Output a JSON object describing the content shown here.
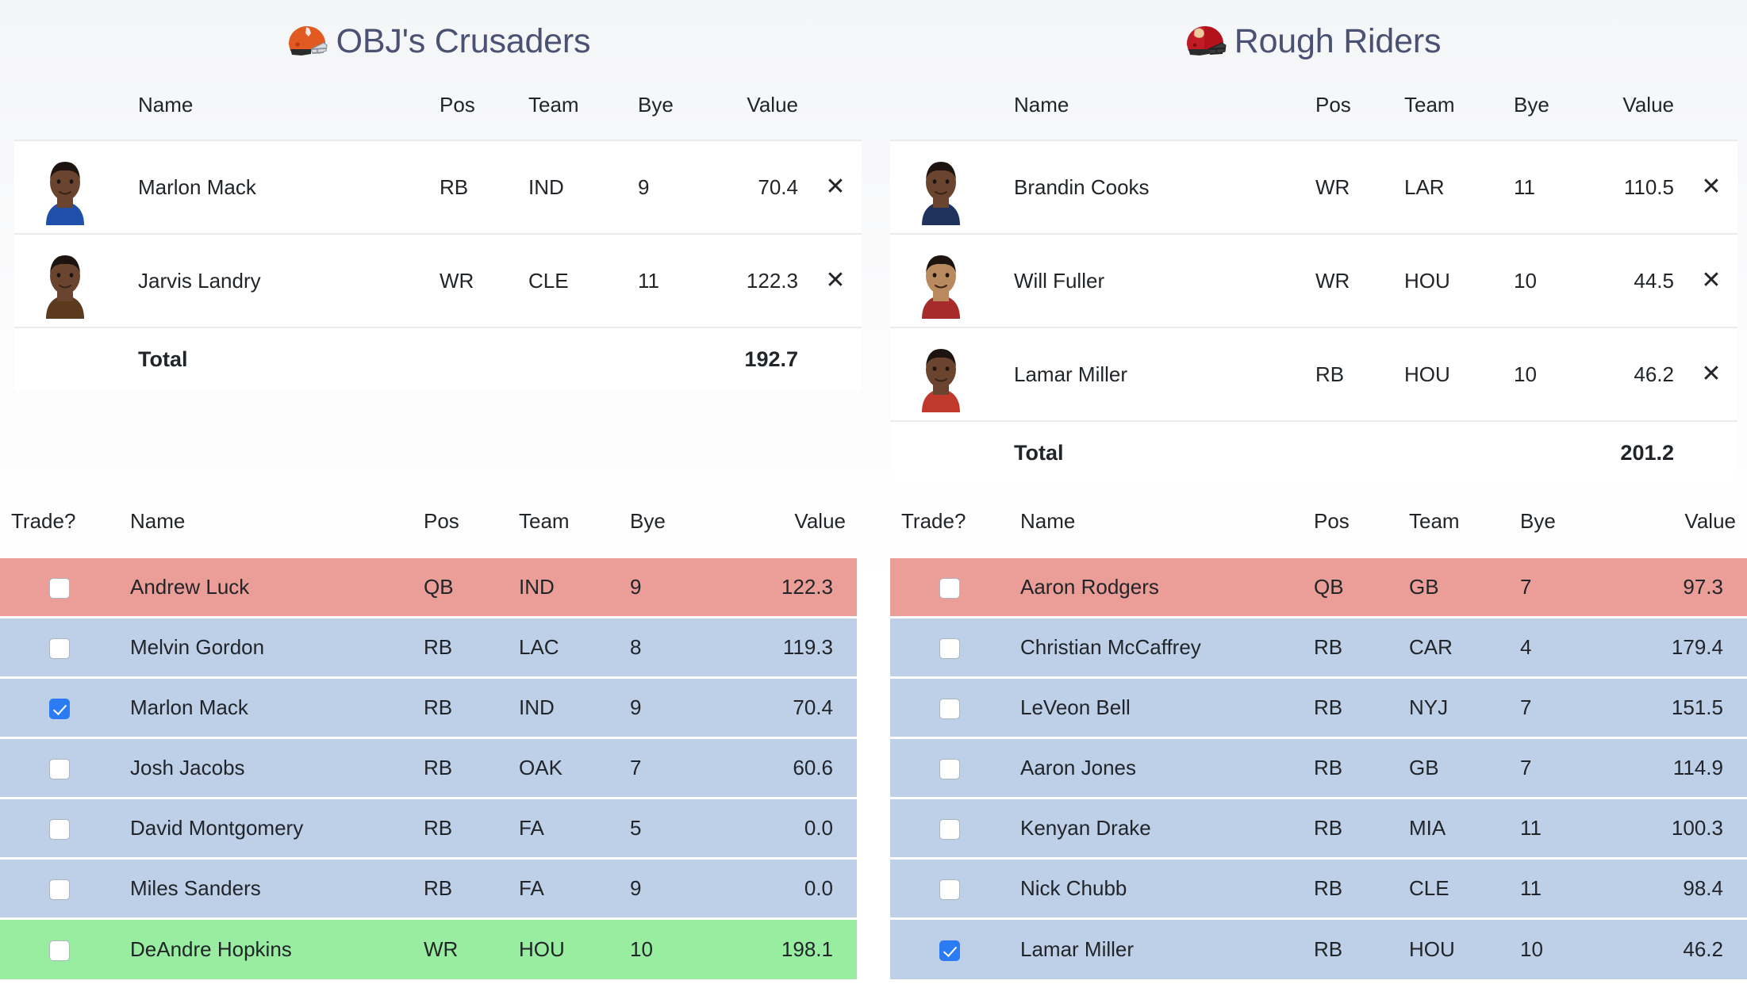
{
  "teams": {
    "left": {
      "name": "OBJ's Crusaders",
      "helmet_icon": "browns-helmet-icon",
      "helmet_shell_color": "#E05A22",
      "helmet_mask_color": "#9AA0A6"
    },
    "right": {
      "name": "Rough Riders",
      "helmet_icon": "red-helmet-icon",
      "helmet_shell_color": "#B3121D",
      "helmet_mask_color": "#2b2b2b"
    }
  },
  "trade_headers": [
    "Name",
    "Pos",
    "Team",
    "Bye",
    "Value"
  ],
  "roster_headers": [
    "Trade?",
    "Name",
    "Pos",
    "Team",
    "Bye",
    "Value"
  ],
  "total_label": "Total",
  "remove_icon": "close-icon",
  "remove_glyph": "✕",
  "colors": {
    "title": "#4a5173",
    "row_qb": "#eb9d98",
    "row_rb": "#bed0e8",
    "row_wr": "#98eda0",
    "checkbox_checked": "#2b7cf4"
  },
  "trade_left": {
    "rows": [
      {
        "name": "Marlon Mack",
        "pos": "RB",
        "team": "IND",
        "bye": "9",
        "value": "70.4",
        "photo_skin": "#6b4430",
        "photo_jersey": "#1f4fa8"
      },
      {
        "name": "Jarvis Landry",
        "pos": "WR",
        "team": "CLE",
        "bye": "11",
        "value": "122.3",
        "photo_skin": "#6b4430",
        "photo_jersey": "#5b3a1e"
      }
    ],
    "total": "192.7"
  },
  "trade_right": {
    "rows": [
      {
        "name": "Brandin Cooks",
        "pos": "WR",
        "team": "LAR",
        "bye": "11",
        "value": "110.5",
        "photo_skin": "#6b4430",
        "photo_jersey": "#20325e"
      },
      {
        "name": "Will Fuller",
        "pos": "WR",
        "team": "HOU",
        "bye": "10",
        "value": "44.5",
        "photo_skin": "#b98a5e",
        "photo_jersey": "#a82b2b"
      },
      {
        "name": "Lamar Miller",
        "pos": "RB",
        "team": "HOU",
        "bye": "10",
        "value": "46.2",
        "photo_skin": "#6b4430",
        "photo_jersey": "#c0392b"
      }
    ],
    "total": "201.2"
  },
  "roster_left": {
    "rows": [
      {
        "checked": false,
        "name": "Andrew Luck",
        "pos": "QB",
        "team": "IND",
        "bye": "9",
        "value": "122.3",
        "color": "red"
      },
      {
        "checked": false,
        "name": "Melvin Gordon",
        "pos": "RB",
        "team": "LAC",
        "bye": "8",
        "value": "119.3",
        "color": "blue"
      },
      {
        "checked": true,
        "name": "Marlon Mack",
        "pos": "RB",
        "team": "IND",
        "bye": "9",
        "value": "70.4",
        "color": "blue"
      },
      {
        "checked": false,
        "name": "Josh Jacobs",
        "pos": "RB",
        "team": "OAK",
        "bye": "7",
        "value": "60.6",
        "color": "blue"
      },
      {
        "checked": false,
        "name": "David Montgomery",
        "pos": "RB",
        "team": "FA",
        "bye": "5",
        "value": "0.0",
        "color": "blue"
      },
      {
        "checked": false,
        "name": "Miles Sanders",
        "pos": "RB",
        "team": "FA",
        "bye": "9",
        "value": "0.0",
        "color": "blue"
      },
      {
        "checked": false,
        "name": "DeAndre Hopkins",
        "pos": "WR",
        "team": "HOU",
        "bye": "10",
        "value": "198.1",
        "color": "green"
      }
    ]
  },
  "roster_right": {
    "rows": [
      {
        "checked": false,
        "name": "Aaron Rodgers",
        "pos": "QB",
        "team": "GB",
        "bye": "7",
        "value": "97.3",
        "color": "red"
      },
      {
        "checked": false,
        "name": "Christian McCaffrey",
        "pos": "RB",
        "team": "CAR",
        "bye": "4",
        "value": "179.4",
        "color": "blue"
      },
      {
        "checked": false,
        "name": "LeVeon Bell",
        "pos": "RB",
        "team": "NYJ",
        "bye": "7",
        "value": "151.5",
        "color": "blue"
      },
      {
        "checked": false,
        "name": "Aaron Jones",
        "pos": "RB",
        "team": "GB",
        "bye": "7",
        "value": "114.9",
        "color": "blue"
      },
      {
        "checked": false,
        "name": "Kenyan Drake",
        "pos": "RB",
        "team": "MIA",
        "bye": "11",
        "value": "100.3",
        "color": "blue"
      },
      {
        "checked": false,
        "name": "Nick Chubb",
        "pos": "RB",
        "team": "CLE",
        "bye": "11",
        "value": "98.4",
        "color": "blue"
      },
      {
        "checked": true,
        "name": "Lamar Miller",
        "pos": "RB",
        "team": "HOU",
        "bye": "10",
        "value": "46.2",
        "color": "blue"
      }
    ]
  }
}
